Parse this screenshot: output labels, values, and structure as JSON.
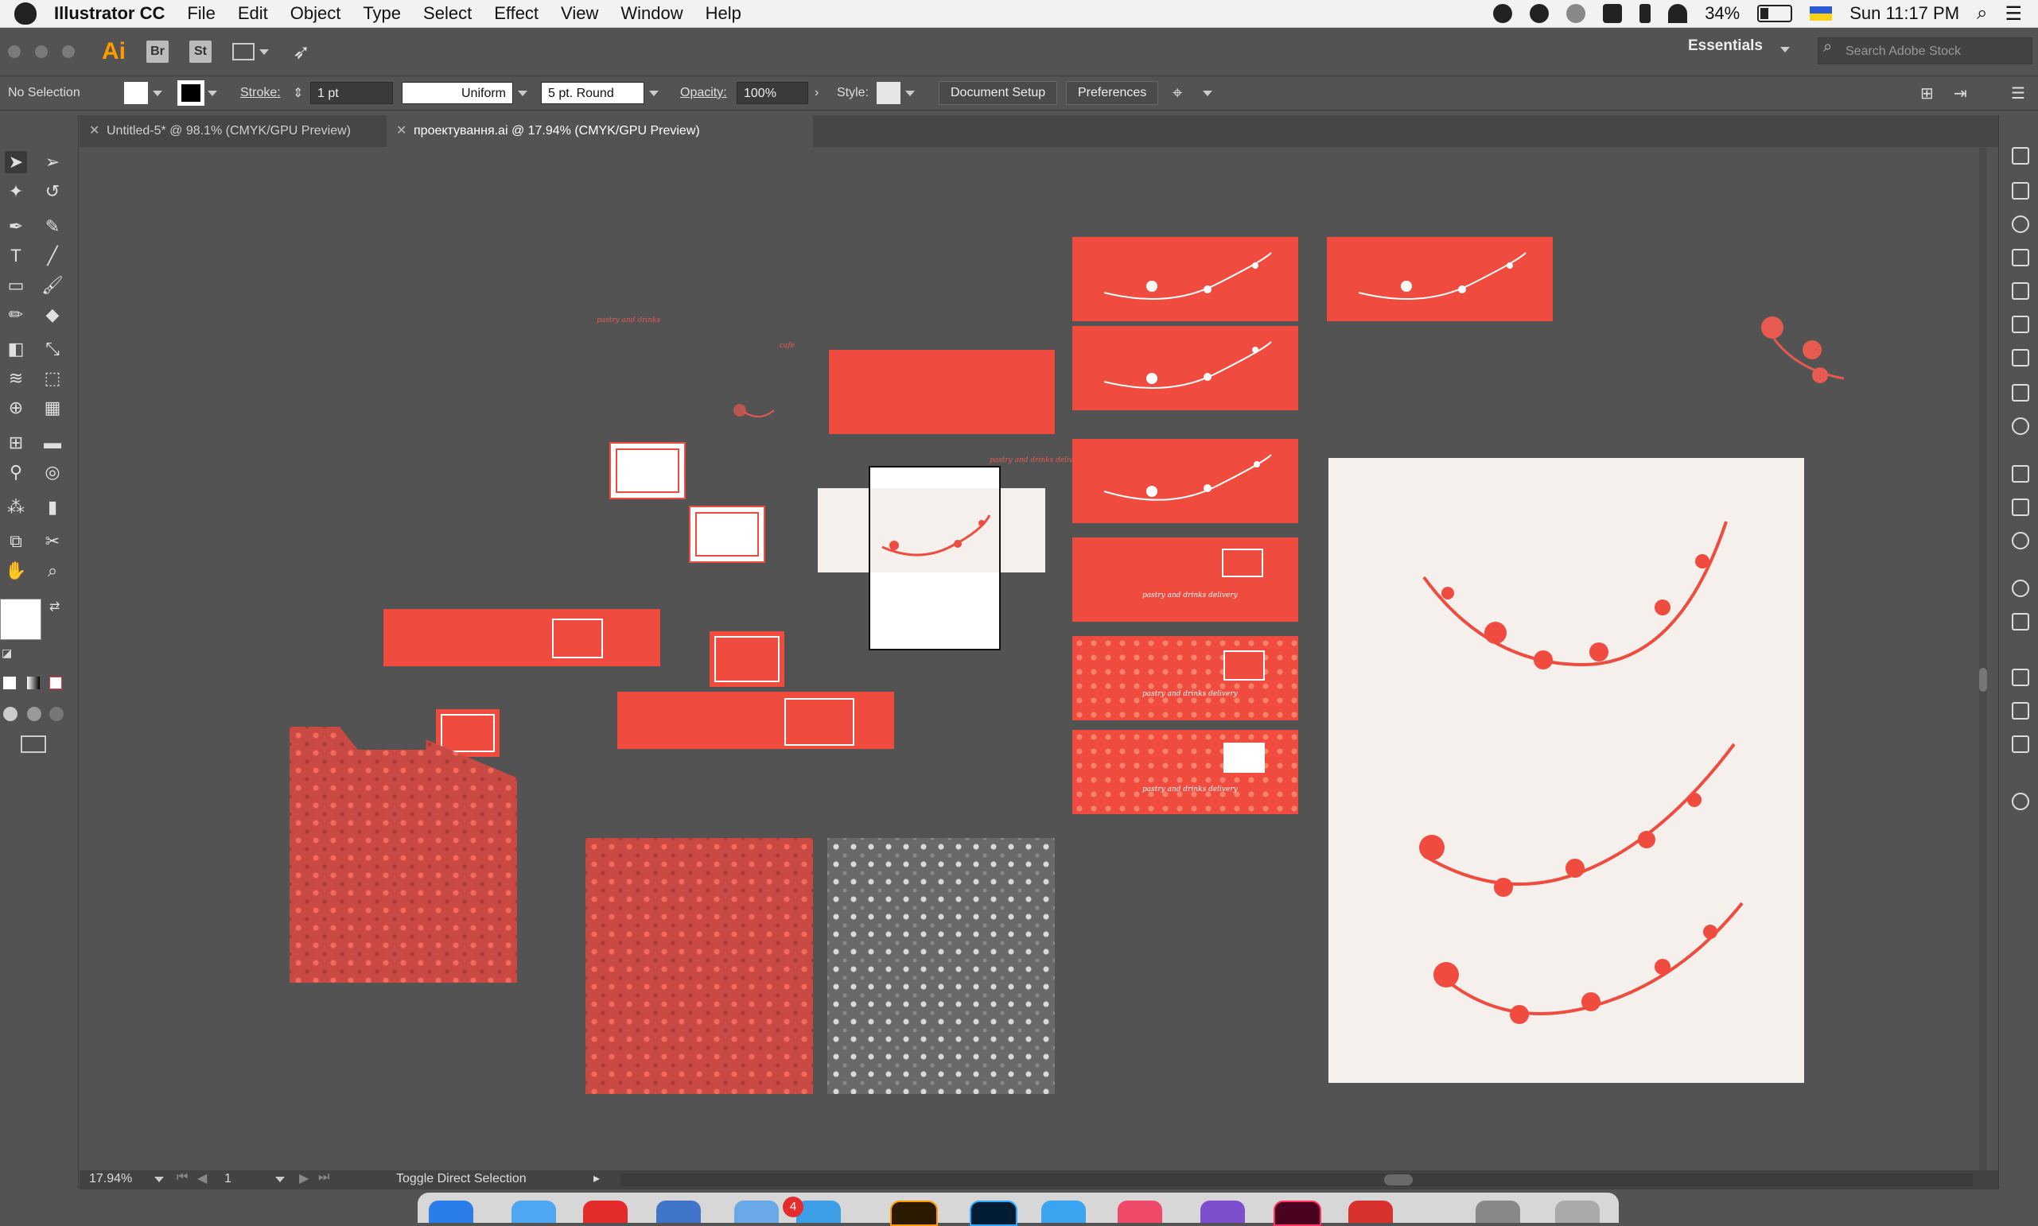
{
  "menubar": {
    "app_name": "Illustrator CC",
    "menus": [
      "File",
      "Edit",
      "Object",
      "Type",
      "Select",
      "Effect",
      "View",
      "Window",
      "Help"
    ],
    "battery": "34%",
    "clock": "Sun 11:17 PM"
  },
  "appbar": {
    "logo": "Ai",
    "bridge": "Br",
    "stock": "St",
    "workspace": "Essentials",
    "stock_search_placeholder": "Search Adobe Stock"
  },
  "controlbar": {
    "selection": "No Selection",
    "stroke_label": "Stroke:",
    "stroke_value": "1 pt",
    "profile": "Uniform",
    "brush": "5 pt. Round",
    "opacity_label": "Opacity:",
    "opacity_value": "100%",
    "style_label": "Style:",
    "document_setup": "Document Setup",
    "preferences": "Preferences"
  },
  "tabs": [
    {
      "label": "Untitled-5* @ 98.1% (CMYK/GPU Preview)"
    },
    {
      "label": "проектування.ai @ 17.94% (CMYK/GPU Preview)"
    }
  ],
  "canvas_text": {
    "tagline": "pastry and drinks",
    "tagline_short": "cafe",
    "delivery": "pastry and drinks delivery",
    "side_tagline": "pastry and drinks delivery"
  },
  "statusbar": {
    "zoom": "17.94%",
    "artboard": "1",
    "message": "Toggle Direct Selection"
  },
  "dock": {
    "badge": "4"
  },
  "colors": {
    "brand_red": "#f04b3f",
    "cream": "#f5f0eb",
    "ui_gray": "#535353"
  }
}
